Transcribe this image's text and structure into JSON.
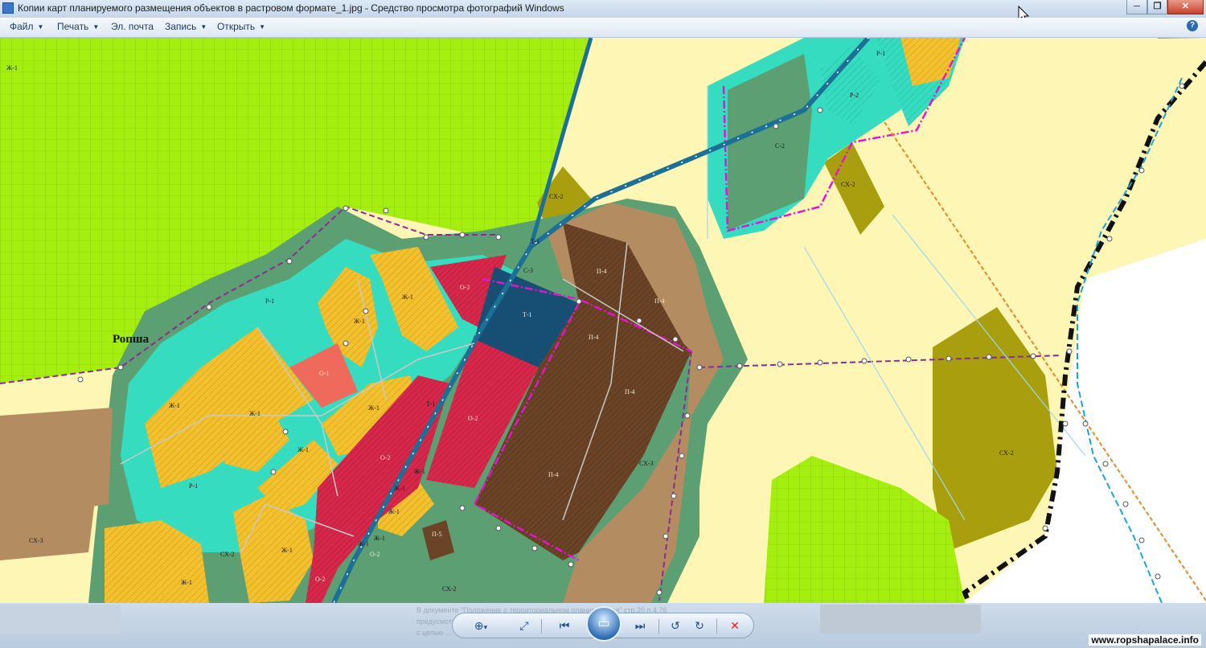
{
  "window": {
    "title": "Копии карт планируемого размещения объектов в растровом формате_1.jpg - Средство просмотра фотографий Windows",
    "minimize_glyph": "─",
    "maximize_glyph": "❐",
    "close_glyph": "✕"
  },
  "menu": {
    "items": [
      {
        "label": "Файл",
        "caret": "▼"
      },
      {
        "label": "Печать",
        "caret": "▼"
      },
      {
        "label": "Эл. почта",
        "caret": ""
      },
      {
        "label": "Запись",
        "caret": "▼"
      },
      {
        "label": "Открыть",
        "caret": "▼"
      }
    ],
    "help_glyph": "?"
  },
  "map": {
    "settlement_label": "Ропша",
    "zones": {
      "zh1": "Ж-1",
      "r1": "Р-1",
      "r2": "Р-2",
      "o1": "О-1",
      "o2": "О-2",
      "t1": "Т-1",
      "p4": "П-4",
      "p5": "П-5",
      "s2": "С-2",
      "s3": "С-3",
      "sh2": "СХ-2",
      "sh3": "СХ-3"
    }
  },
  "toolbar": {
    "zoom_icon": "⊕",
    "zoom_caret": "▾",
    "fit_icon": "⤢",
    "prev_icon": "⏮",
    "slideshow_icon": "▭",
    "next_icon": "⏭",
    "rotate_left_icon": "↺",
    "rotate_right_icon": "↻",
    "delete_icon": "✕"
  },
  "background_ghost_text": {
    "line1": "В документе \"Положение о территориальном планировании\" стр.20 п.4.76",
    "line2": "предусмотрено ...",
    "line3": "с целью ..."
  },
  "watermark": "www.ropshapalace.info",
  "colors": {
    "residential": "#f3c02e",
    "recreation": "#36dcc0",
    "public": "#d6284a",
    "industrial": "#6b4326",
    "transport": "#164f73",
    "agri_lime": "#a5ef10",
    "agri_pale": "#fdf6b4",
    "agri_olive": "#a89e0e",
    "tan": "#b38c62",
    "forest": "#5c9f72",
    "boundary": "#e515cf",
    "road": "#1c6f97"
  }
}
